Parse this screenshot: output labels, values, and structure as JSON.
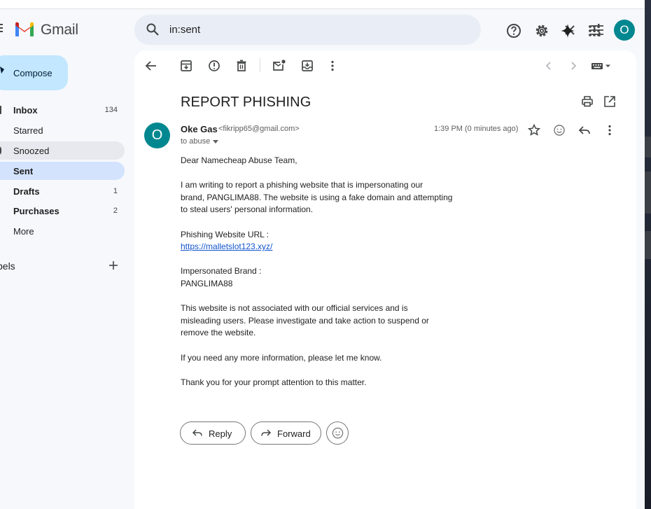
{
  "app": {
    "logo_text": "Gmail",
    "colors": {
      "accent": "#0b57d0",
      "avatar": "#00878f",
      "compose": "#c2e7ff",
      "active_nav": "#d3e3fd"
    }
  },
  "search": {
    "value": "in:sent",
    "icons": [
      "search-icon",
      "clear-search-icon",
      "search-options-icon"
    ]
  },
  "header": {
    "avatar_letter": "O",
    "icons": [
      "help-icon",
      "settings-icon",
      "gemini-icon",
      "apps-grid-icon"
    ]
  },
  "sidebar": {
    "compose_label": "Compose",
    "items": [
      {
        "label": "Inbox",
        "count": "134",
        "bold": true
      },
      {
        "label": "Starred",
        "count": ""
      },
      {
        "label": "Snoozed",
        "count": ""
      },
      {
        "label": "Sent",
        "count": "",
        "bold": true,
        "active": true
      },
      {
        "label": "Drafts",
        "count": "1",
        "bold": true
      },
      {
        "label": "Purchases",
        "count": "2",
        "bold": true
      },
      {
        "label": "More",
        "count": ""
      }
    ],
    "labels_title": "bels"
  },
  "toolbar": {
    "icons": [
      "back-arrow-icon",
      "archive-icon",
      "report-spam-icon",
      "delete-icon",
      "mark-unread-icon",
      "move-to-icon",
      "more-vert-icon",
      "newer-icon",
      "older-icon",
      "input-tools-icon"
    ]
  },
  "email": {
    "subject": "REPORT PHISHING",
    "sender_initial": "O",
    "sender_name": "Oke Gas",
    "sender_email": "<fikripp65@gmail.com>",
    "to": "to abuse",
    "time": "1:39 PM (0 minutes ago)",
    "greeting": "Dear Namecheap Abuse Team,",
    "para1_l1": "I am writing to report a phishing website that is impersonating our",
    "para1_l2": "brand, PANGLIMA88. The website is using a fake domain and attempting",
    "para1_l3": "to steal users' personal information.",
    "url_label": "Phishing Website URL :",
    "url": "https://malletslot123.xyz/",
    "brand_label": "Impersonated Brand :",
    "brand": "PANGLIMA88",
    "para2_l1": "This website is not associated with our official services and is",
    "para2_l2": "misleading users. Please investigate and take action to suspend or",
    "para2_l3": "remove the website.",
    "para3": "If you need any more information, please let me know.",
    "closing": "Thank you for your prompt attention to this matter."
  },
  "actions": {
    "reply_label": "Reply",
    "forward_label": "Forward"
  }
}
